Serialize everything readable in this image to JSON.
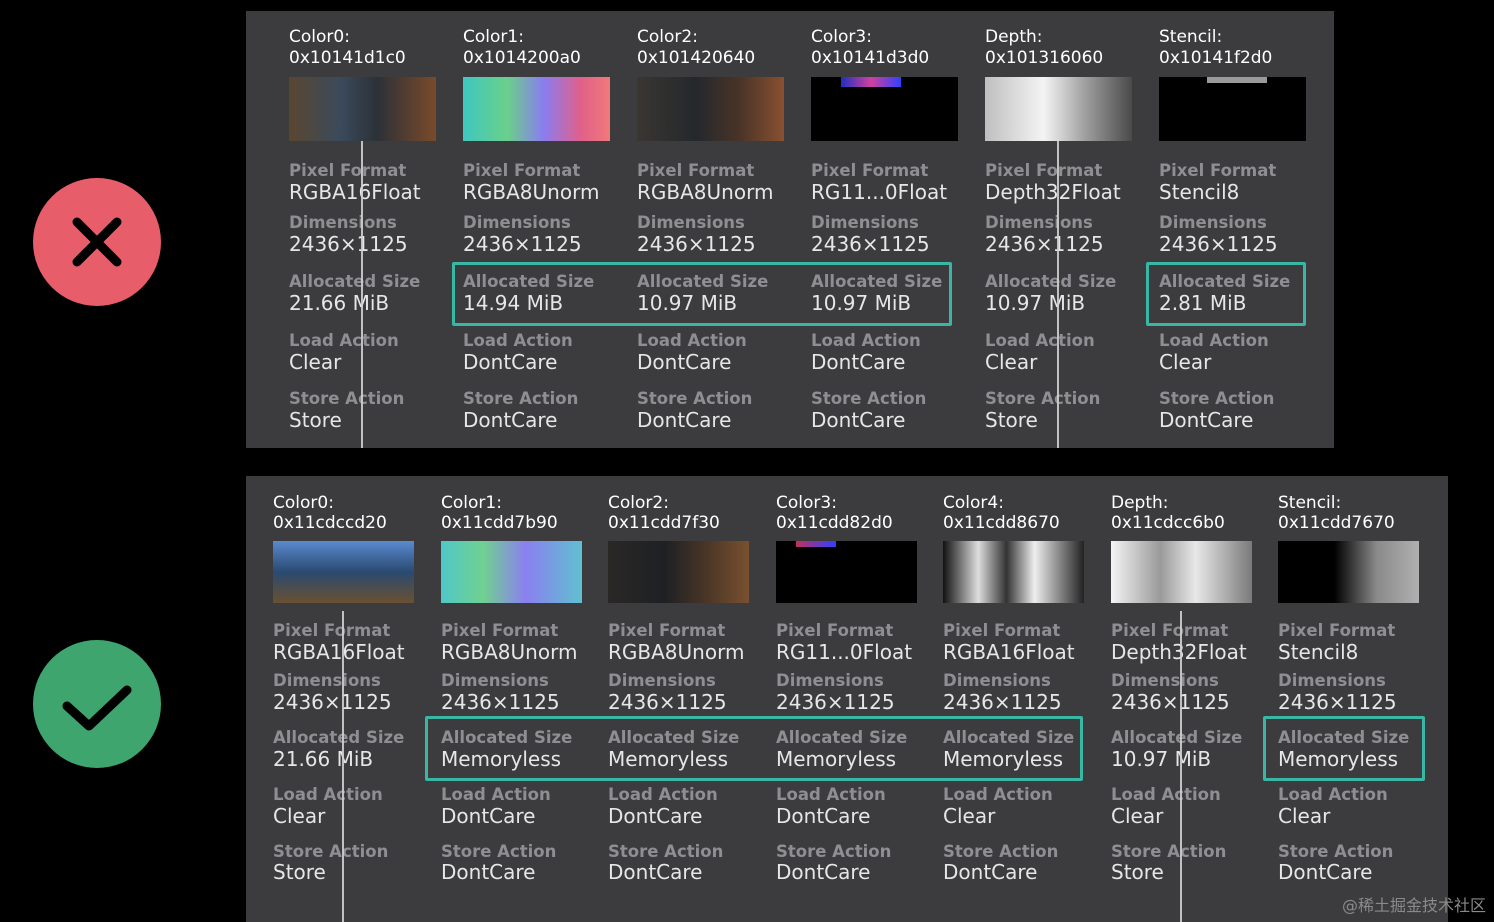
{
  "colors": {
    "fail": "#e85d6a",
    "pass": "#3ea56e",
    "highlight": "#37b7a4",
    "panel": "#3c3c3e"
  },
  "labels": {
    "pixel_format": "Pixel Format",
    "dimensions": "Dimensions",
    "allocated_size": "Allocated Size",
    "load_action": "Load Action",
    "store_action": "Store Action"
  },
  "top_panel": {
    "badge_icon": "cross-icon",
    "attachments": [
      {
        "name": "Color0:",
        "address": "0x10141d1c0",
        "pixel_format": "RGBA16Float",
        "dimensions": "2436×1125",
        "allocated_size": "21.66 MiB",
        "load_action": "Clear",
        "store_action": "Store"
      },
      {
        "name": "Color1:",
        "address": "0x1014200a0",
        "pixel_format": "RGBA8Unorm",
        "dimensions": "2436×1125",
        "allocated_size": "14.94 MiB",
        "load_action": "DontCare",
        "store_action": "DontCare"
      },
      {
        "name": "Color2:",
        "address": "0x101420640",
        "pixel_format": "RGBA8Unorm",
        "dimensions": "2436×1125",
        "allocated_size": "10.97 MiB",
        "load_action": "DontCare",
        "store_action": "DontCare"
      },
      {
        "name": "Color3:",
        "address": "0x10141d3d0",
        "pixel_format": "RG11...0Float",
        "dimensions": "2436×1125",
        "allocated_size": "10.97 MiB",
        "load_action": "DontCare",
        "store_action": "DontCare"
      },
      {
        "name": "Depth:",
        "address": "0x101316060",
        "pixel_format": "Depth32Float",
        "dimensions": "2436×1125",
        "allocated_size": "10.97 MiB",
        "load_action": "Clear",
        "store_action": "Store"
      },
      {
        "name": "Stencil:",
        "address": "0x10141f2d0",
        "pixel_format": "Stencil8",
        "dimensions": "2436×1125",
        "allocated_size": "2.81 MiB",
        "load_action": "Clear",
        "store_action": "DontCare"
      }
    ]
  },
  "bottom_panel": {
    "badge_icon": "check-icon",
    "attachments": [
      {
        "name": "Color0:",
        "address": "0x11cdccd20",
        "pixel_format": "RGBA16Float",
        "dimensions": "2436×1125",
        "allocated_size": "21.66 MiB",
        "load_action": "Clear",
        "store_action": "Store"
      },
      {
        "name": "Color1:",
        "address": "0x11cdd7b90",
        "pixel_format": "RGBA8Unorm",
        "dimensions": "2436×1125",
        "allocated_size": "Memoryless",
        "load_action": "DontCare",
        "store_action": "DontCare"
      },
      {
        "name": "Color2:",
        "address": "0x11cdd7f30",
        "pixel_format": "RGBA8Unorm",
        "dimensions": "2436×1125",
        "allocated_size": "Memoryless",
        "load_action": "DontCare",
        "store_action": "DontCare"
      },
      {
        "name": "Color3:",
        "address": "0x11cdd82d0",
        "pixel_format": "RG11...0Float",
        "dimensions": "2436×1125",
        "allocated_size": "Memoryless",
        "load_action": "DontCare",
        "store_action": "DontCare"
      },
      {
        "name": "Color4:",
        "address": "0x11cdd8670",
        "pixel_format": "RGBA16Float",
        "dimensions": "2436×1125",
        "allocated_size": "Memoryless",
        "load_action": "Clear",
        "store_action": "DontCare"
      },
      {
        "name": "Depth:",
        "address": "0x11cdcc6b0",
        "pixel_format": "Depth32Float",
        "dimensions": "2436×1125",
        "allocated_size": "10.97 MiB",
        "load_action": "Clear",
        "store_action": "Store"
      },
      {
        "name": "Stencil:",
        "address": "0x11cdd7670",
        "pixel_format": "Stencil8",
        "dimensions": "2436×1125",
        "allocated_size": "Memoryless",
        "load_action": "Clear",
        "store_action": "DontCare"
      }
    ]
  },
  "watermark": "@稀土掘金技术社区"
}
